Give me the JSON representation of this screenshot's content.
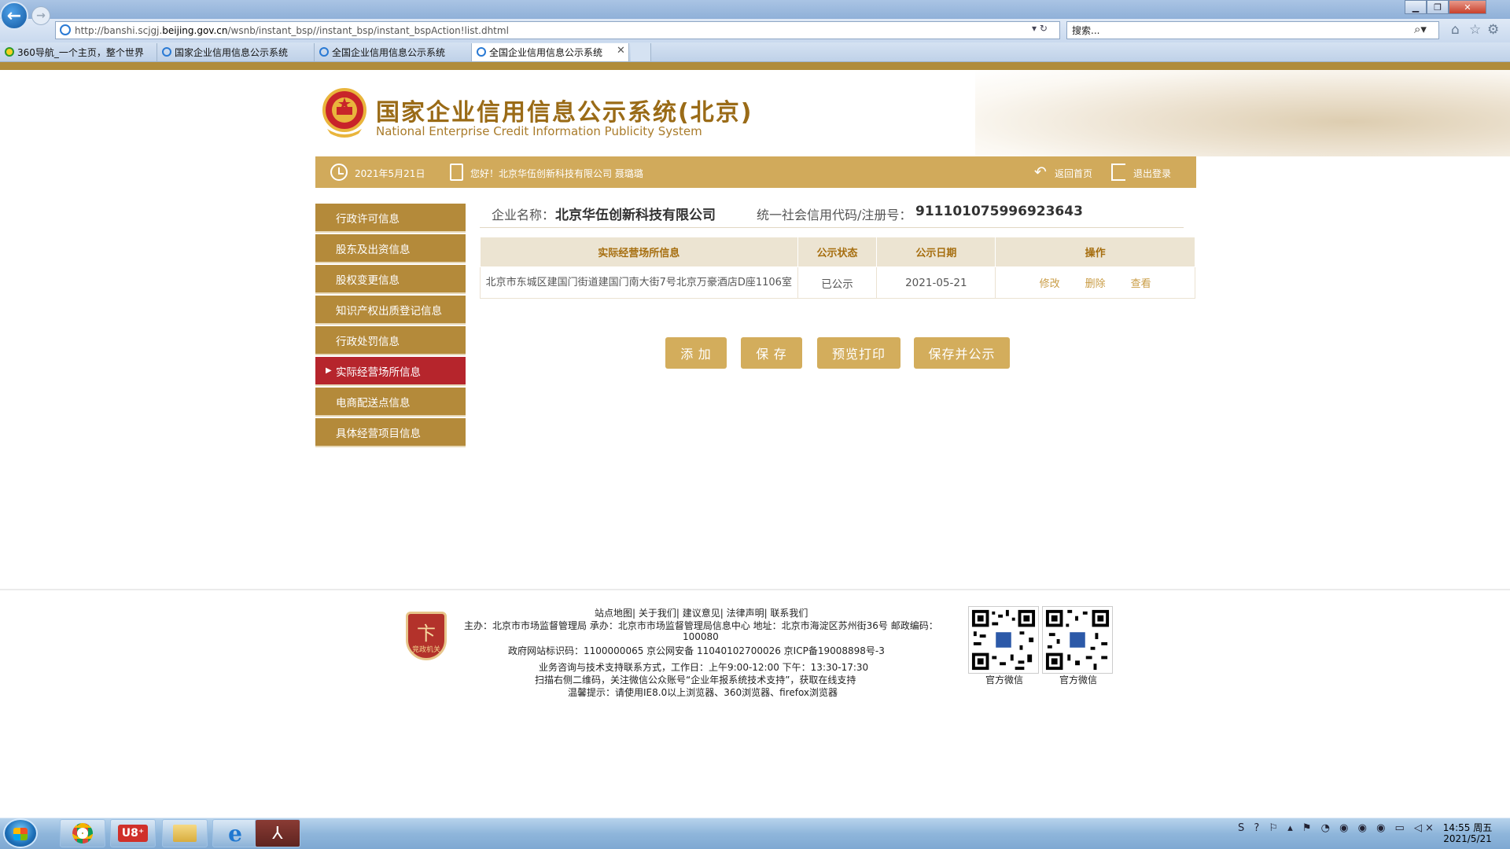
{
  "browser": {
    "url_prefix": "http://banshi.scjgj.",
    "url_domain": "beijing.gov.cn",
    "url_suffix": "/wsnb/instant_bsp//instant_bsp/instant_bspAction!list.dhtml",
    "search_placeholder": "搜索...",
    "tabs": [
      {
        "label": "360导航_一个主页，整个世界"
      },
      {
        "label": "国家企业信用信息公示系统"
      },
      {
        "label": "全国企业信用信息公示系统"
      },
      {
        "label": "全国企业信用信息公示系统"
      }
    ]
  },
  "header": {
    "title": "国家企业信用信息公示系统(北京)",
    "subtitle": "National Enterprise Credit Information Publicity System"
  },
  "infobar": {
    "date": "2021年5月21日",
    "greeting": "您好！北京华伍创新科技有限公司  聂璐璐",
    "home_link": "返回首页",
    "logout_link": "退出登录"
  },
  "sidebar": {
    "items": [
      {
        "label": "行政许可信息"
      },
      {
        "label": "股东及出资信息"
      },
      {
        "label": "股权变更信息"
      },
      {
        "label": "知识产权出质登记信息"
      },
      {
        "label": "行政处罚信息"
      },
      {
        "label": "实际经营场所信息"
      },
      {
        "label": "电商配送点信息"
      },
      {
        "label": "具体经营项目信息"
      }
    ],
    "active_index": 5
  },
  "content": {
    "company_label": "企业名称：",
    "company_name": "北京华伍创新科技有限公司",
    "credit_label": "统一社会信用代码/注册号：",
    "credit_code": "911101075996923643",
    "table": {
      "headers": [
        "实际经营场所信息",
        "公示状态",
        "公示日期",
        "操作"
      ],
      "rows": [
        {
          "address": "北京市东城区建国门街道建国门南大街7号北京万豪酒店D座1106室",
          "status": "已公示",
          "date": "2021-05-21",
          "ops": [
            "修改",
            "删除",
            "查看"
          ]
        }
      ]
    },
    "buttons": {
      "add": "添 加",
      "save": "保 存",
      "print": "预览打印",
      "publish": "保存并公示"
    }
  },
  "footer": {
    "badge_text": "竞政机关",
    "links": "站点地图| 关于我们| 建议意见| 法律声明| 联系我们",
    "host": "主办：北京市市场监督管理局  承办：北京市市场监督管理局信息中心  地址：北京市海淀区苏州街36号  邮政编码：",
    "zip": "100080",
    "ids": "政府网站标识码：1100000065      京公网安备 11040102700026      京ICP备19008898号-3",
    "hours": "业务咨询与技术支持联系方式，工作日：上午9:00-12:00 下午：13:30-17:30",
    "wechat": "扫描右侧二维码，关注微信公众账号“企业年报系统技术支持”，获取在线支持",
    "tip": "温馨提示：请使用IE8.0以上浏览器、360浏览器、firefox浏览器",
    "qr_captions": [
      "官方微信",
      "官方微信"
    ]
  },
  "taskbar": {
    "time": "14:55 周五",
    "date": "2021/5/21"
  },
  "colors": {
    "gold": "#d1aa5b",
    "sidebar": "#b48a3a",
    "active": "#b6252c"
  }
}
